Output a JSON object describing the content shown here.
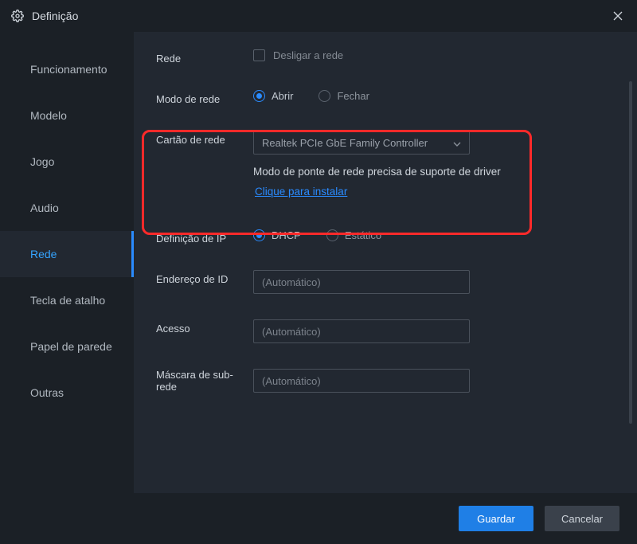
{
  "window": {
    "title": "Definição"
  },
  "sidebar": {
    "items": [
      {
        "label": "Funcionamento"
      },
      {
        "label": "Modelo"
      },
      {
        "label": "Jogo"
      },
      {
        "label": "Audio"
      },
      {
        "label": "Rede"
      },
      {
        "label": "Tecla de atalho"
      },
      {
        "label": "Papel de parede"
      },
      {
        "label": "Outras"
      }
    ],
    "active_index": 4
  },
  "content": {
    "rede": {
      "label": "Rede",
      "checkbox_label": "Desligar a rede",
      "checked": false
    },
    "modo_rede": {
      "label": "Modo de rede",
      "opt_open": "Abrir",
      "opt_close": "Fechar",
      "value": "Abrir"
    },
    "cartao_rede": {
      "label": "Cartão de rede",
      "selected": "Realtek PCIe GbE Family Controller",
      "hint": "Modo de ponte de rede precisa de suporte de driver",
      "link": "Clique para instalar"
    },
    "def_ip": {
      "label": "Definição de IP",
      "opt_dhcp": "DHCP",
      "opt_static": "Estático",
      "value": "DHCP"
    },
    "endereco": {
      "label": "Endereço de ID",
      "placeholder": "(Automático)",
      "value": ""
    },
    "acesso": {
      "label": "Acesso",
      "placeholder": "(Automático)",
      "value": ""
    },
    "mascara": {
      "label": "Máscara de sub-rede",
      "placeholder": "(Automático)",
      "value": ""
    }
  },
  "footer": {
    "save": "Guardar",
    "cancel": "Cancelar"
  }
}
